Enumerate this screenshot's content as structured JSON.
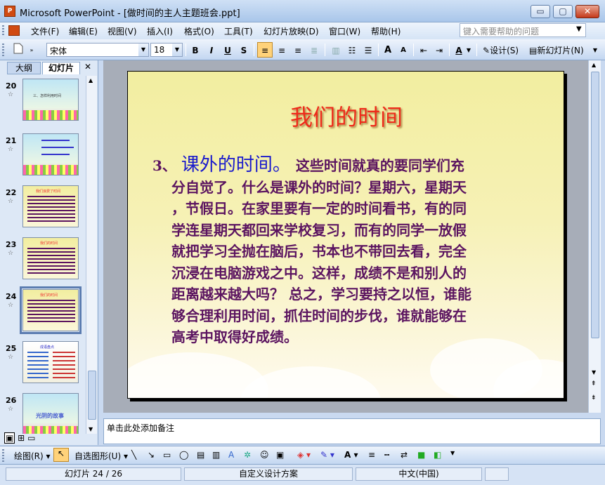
{
  "window": {
    "title": "Microsoft PowerPoint - [做时间的主人主题班会.ppt]",
    "app_icon": "P",
    "minimize": "▭",
    "maximize": "▢",
    "close": "✕"
  },
  "menu": {
    "items": [
      "文件(F)",
      "编辑(E)",
      "视图(V)",
      "插入(I)",
      "格式(O)",
      "工具(T)",
      "幻灯片放映(D)",
      "窗口(W)",
      "帮助(H)"
    ],
    "help_placeholder": "键入需要帮助的问题"
  },
  "toolbar": {
    "font": "宋体",
    "size": "18",
    "bold": "B",
    "italic": "I",
    "underline": "U",
    "shadow": "S",
    "grow": "A",
    "shrink": "A",
    "design": "设计(S)",
    "new_slide": "新幻灯片(N)"
  },
  "left_pane": {
    "tab_outline": "大纲",
    "tab_slides": "幻灯片",
    "close": "✕",
    "slides": [
      {
        "num": "20",
        "label": "三、怎样利用时间"
      },
      {
        "num": "21",
        "label": ""
      },
      {
        "num": "22",
        "label": "我们浪费了时间"
      },
      {
        "num": "23",
        "label": "我们的时间"
      },
      {
        "num": "24",
        "label": "我们的时间"
      },
      {
        "num": "25",
        "label": "成语盘点"
      },
      {
        "num": "26",
        "label": "光阴的故事"
      }
    ],
    "selected": "24"
  },
  "slide": {
    "title": "我们的时间",
    "number": "3、",
    "heading": "课外的时间。",
    "lines": [
      "这些时间就真的要同学们充",
      "分自觉了。什么是课外的时间？星期六，星期天",
      "，节假日。在家里要有一定的时间看书，有的同",
      "学连星期天都回来学校复习，而有的同学一放假",
      "就把学习全抛在脑后，书本也不带回去看，完全",
      "沉浸在电脑游戏之中。这样，成绩不是和别人的",
      "距离越来越大吗？ 总之，学习要持之以恒，谁能",
      "够合理利用时间，抓住时间的步伐，谁就能够在",
      "高考中取得好成绩。"
    ]
  },
  "notes": {
    "placeholder": "单击此处添加备注"
  },
  "drawing": {
    "draw": "绘图(R)",
    "autoshapes": "自选图形(U)"
  },
  "status": {
    "slide": "幻灯片 24 / 26",
    "design": "自定义设计方案",
    "language": "中文(中国)"
  }
}
